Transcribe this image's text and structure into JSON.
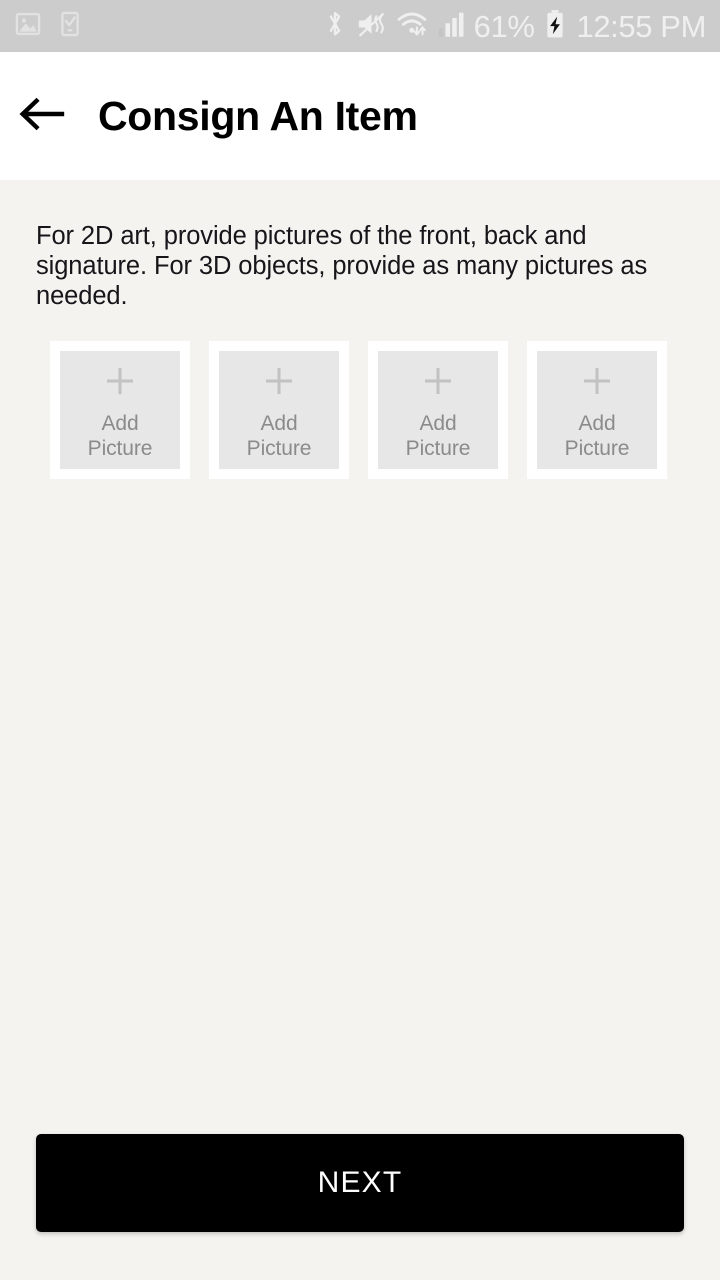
{
  "statusbar": {
    "background": "#cccccc",
    "left_icons": [
      {
        "name": "photo-icon",
        "label": "image"
      },
      {
        "name": "device-checkmark-icon",
        "label": "phone-setup-complete"
      }
    ],
    "right_icons": [
      {
        "name": "bluetooth-icon",
        "label": "bluetooth"
      },
      {
        "name": "mute-vibrate-icon",
        "label": "sound-muted"
      },
      {
        "name": "wifi-icon",
        "label": "wifi-with-data-transfer"
      },
      {
        "name": "cellular-signal-icon",
        "label": "cellular-signal"
      }
    ],
    "battery_percent": "61%",
    "battery_icon": "battery-charging-icon",
    "time": "12:55 PM"
  },
  "header": {
    "back_icon": "arrow-left-icon",
    "title": "Consign An Item",
    "background": "#ffffff"
  },
  "content": {
    "background": "#f4f3ef",
    "instructions": "For 2D art, provide pictures of the front, back and signature. For 3D objects, provide as many pictures as needed.",
    "tiles": [
      {
        "icon": "plus-icon",
        "label_line1": "Add",
        "label_line2": "Picture"
      },
      {
        "icon": "plus-icon",
        "label_line1": "Add",
        "label_line2": "Picture"
      },
      {
        "icon": "plus-icon",
        "label_line1": "Add",
        "label_line2": "Picture"
      },
      {
        "icon": "plus-icon",
        "label_line1": "Add",
        "label_line2": "Picture"
      }
    ]
  },
  "footer": {
    "next_label": "NEXT",
    "next_background": "#000000",
    "next_text_color": "#ffffff"
  }
}
